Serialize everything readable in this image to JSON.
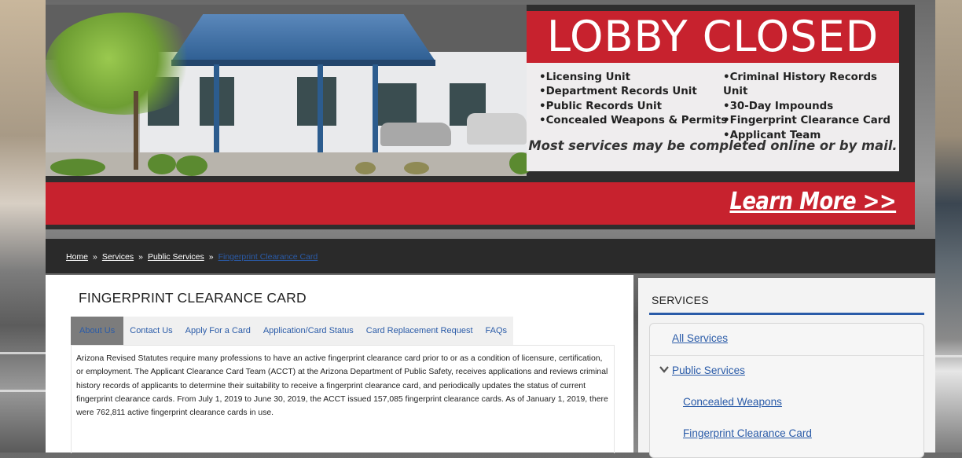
{
  "banner": {
    "headline": "LOBBY CLOSED",
    "units_left": [
      "Licensing Unit",
      "Department Records Unit",
      "Public Records Unit",
      "Concealed Weapons & Permits"
    ],
    "units_right": [
      "Criminal History Records Unit",
      "30-Day Impounds",
      "Fingerprint Clearance Card",
      "Applicant Team"
    ],
    "note": "Most services may be completed online or by mail.",
    "cta": "Learn More >>",
    "colors": {
      "brand_red": "#c7222e",
      "link_blue": "#2a5ba8"
    }
  },
  "breadcrumb": {
    "items": [
      "Home",
      "Services",
      "Public Services"
    ],
    "current": "Fingerprint Clearance Card",
    "separator": "»"
  },
  "main": {
    "title": "FINGERPRINT CLEARANCE CARD",
    "tabs": [
      "About Us",
      "Contact Us",
      "Apply For a Card",
      "Application/Card Status",
      "Card Replacement Request",
      "FAQs"
    ],
    "active_tab": "About Us",
    "paragraph": "Arizona Revised Statutes require many professions to have an active fingerprint clearance card prior to or as a condition of licensure, certification, or employment.  The Applicant Clearance Card Team (ACCT) at the Arizona Department of Public Safety, receives applications and reviews criminal history records of applicants to determine their suitability to receive a fingerprint clearance card, and periodically updates the status of current fingerprint clearance cards.  From July 1, 2019 to June 30, 2019, the ACCT issued 157,085 fingerprint clearance cards.  As of January 1, 2019, there were 762,811 active fingerprint clearance cards in use."
  },
  "sidebar": {
    "title": "SERVICES",
    "items": [
      {
        "label": "All Services"
      },
      {
        "label": "Public Services",
        "icon": "chevron-down-icon"
      },
      {
        "label": "Concealed Weapons"
      },
      {
        "label": "Fingerprint Clearance Card"
      }
    ]
  }
}
